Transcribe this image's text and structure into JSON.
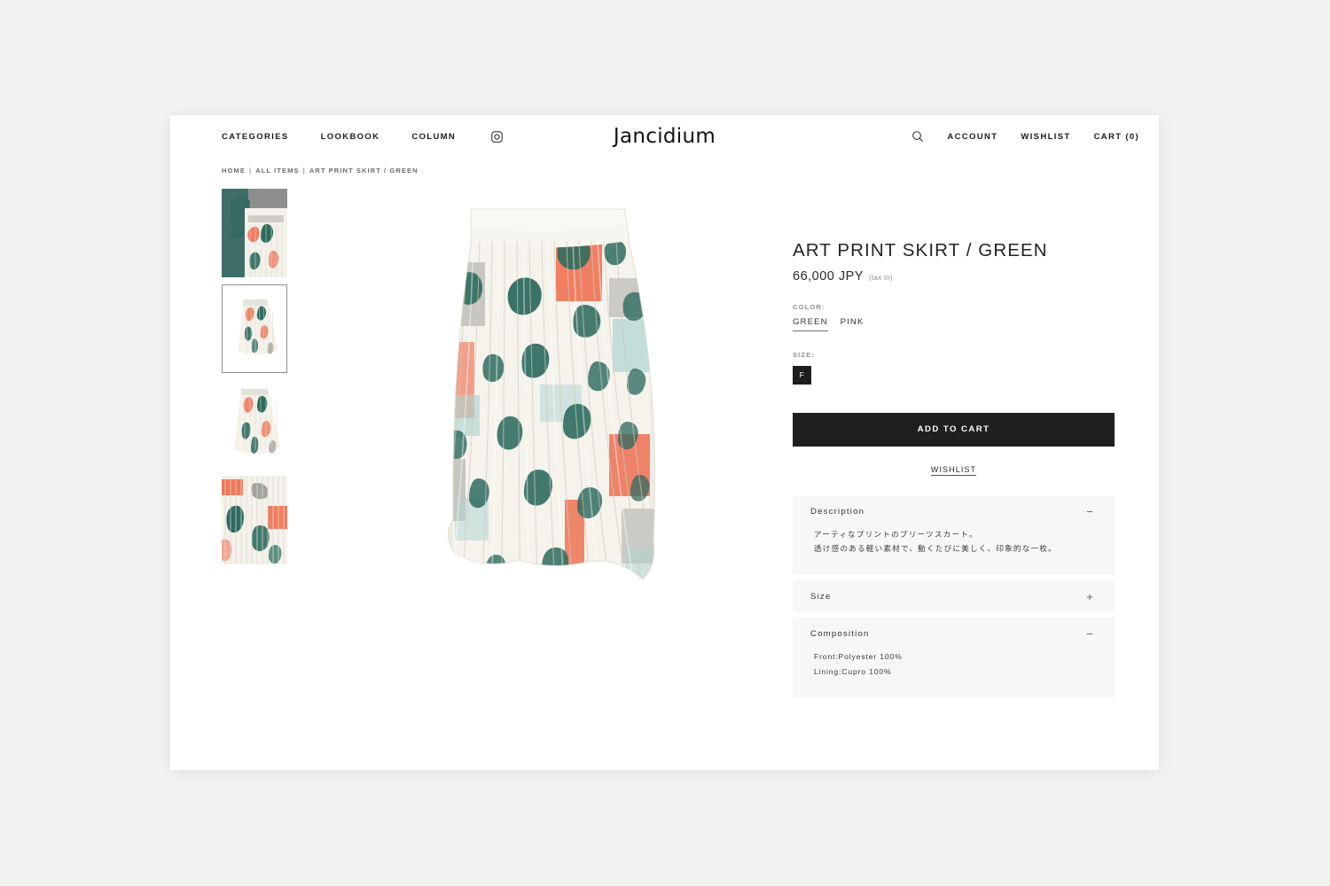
{
  "header": {
    "brand": "Jancidium",
    "nav_left": [
      {
        "label": "CATEGORIES"
      },
      {
        "label": "LOOKBOOK"
      },
      {
        "label": "COLUMN"
      }
    ],
    "instagram_icon": "instagram-icon",
    "search_icon": "search-icon",
    "nav_right": [
      {
        "label": "ACCOUNT"
      },
      {
        "label": "WISHLIST"
      },
      {
        "label": "CART (0)"
      }
    ]
  },
  "breadcrumb": {
    "items": [
      "HOME",
      "ALL ITEMS",
      "ART PRINT SKIRT / GREEN"
    ],
    "separator": "|"
  },
  "gallery": {
    "thumbnails": [
      {
        "alt": "model wearing art print skirt with teal blouse",
        "selected": false
      },
      {
        "alt": "art print skirt full front view on white",
        "selected": true
      },
      {
        "alt": "art print skirt front view detail",
        "selected": false
      },
      {
        "alt": "art print skirt fabric close up",
        "selected": false
      }
    ],
    "main_image_alt": "ART PRINT SKIRT / GREEN pleated midi skirt"
  },
  "product": {
    "title": "ART PRINT SKIRT / GREEN",
    "price": "66,000 JPY",
    "tax_note": "(tax in)",
    "color_label": "COLOR:",
    "colors": [
      {
        "label": "GREEN",
        "selected": true
      },
      {
        "label": "PINK",
        "selected": false
      }
    ],
    "size_label": "SIZE:",
    "sizes": [
      {
        "label": "F",
        "selected": true
      }
    ],
    "add_to_cart_label": "ADD TO CART",
    "wishlist_label": "WISHLIST"
  },
  "accordions": [
    {
      "title": "Description",
      "toggle": "−",
      "expanded": true,
      "lines": [
        "アーティなプリントのプリーツスカート。",
        "透け感のある軽い素材で、動くたびに美しく、印象的な一枚。"
      ],
      "japanese": true
    },
    {
      "title": "Size",
      "toggle": "+",
      "expanded": false,
      "lines": [],
      "japanese": false
    },
    {
      "title": "Composition",
      "toggle": "−",
      "expanded": true,
      "lines": [
        "Front:Polyester 100%",
        "Lining:Cupro 100%"
      ],
      "japanese": false
    }
  ],
  "colors_meta": {
    "page_background": "#f2f2f1",
    "card_background": "#ffffff",
    "accent_dark": "#1f1f1f",
    "accordion_background": "#f7f7f7",
    "print_coral": "#ee6a4a",
    "print_teal": "#2e6b5f",
    "print_gray": "#9a9a95",
    "print_mint": "#aed4d0",
    "print_cream": "#f4f1ea"
  }
}
